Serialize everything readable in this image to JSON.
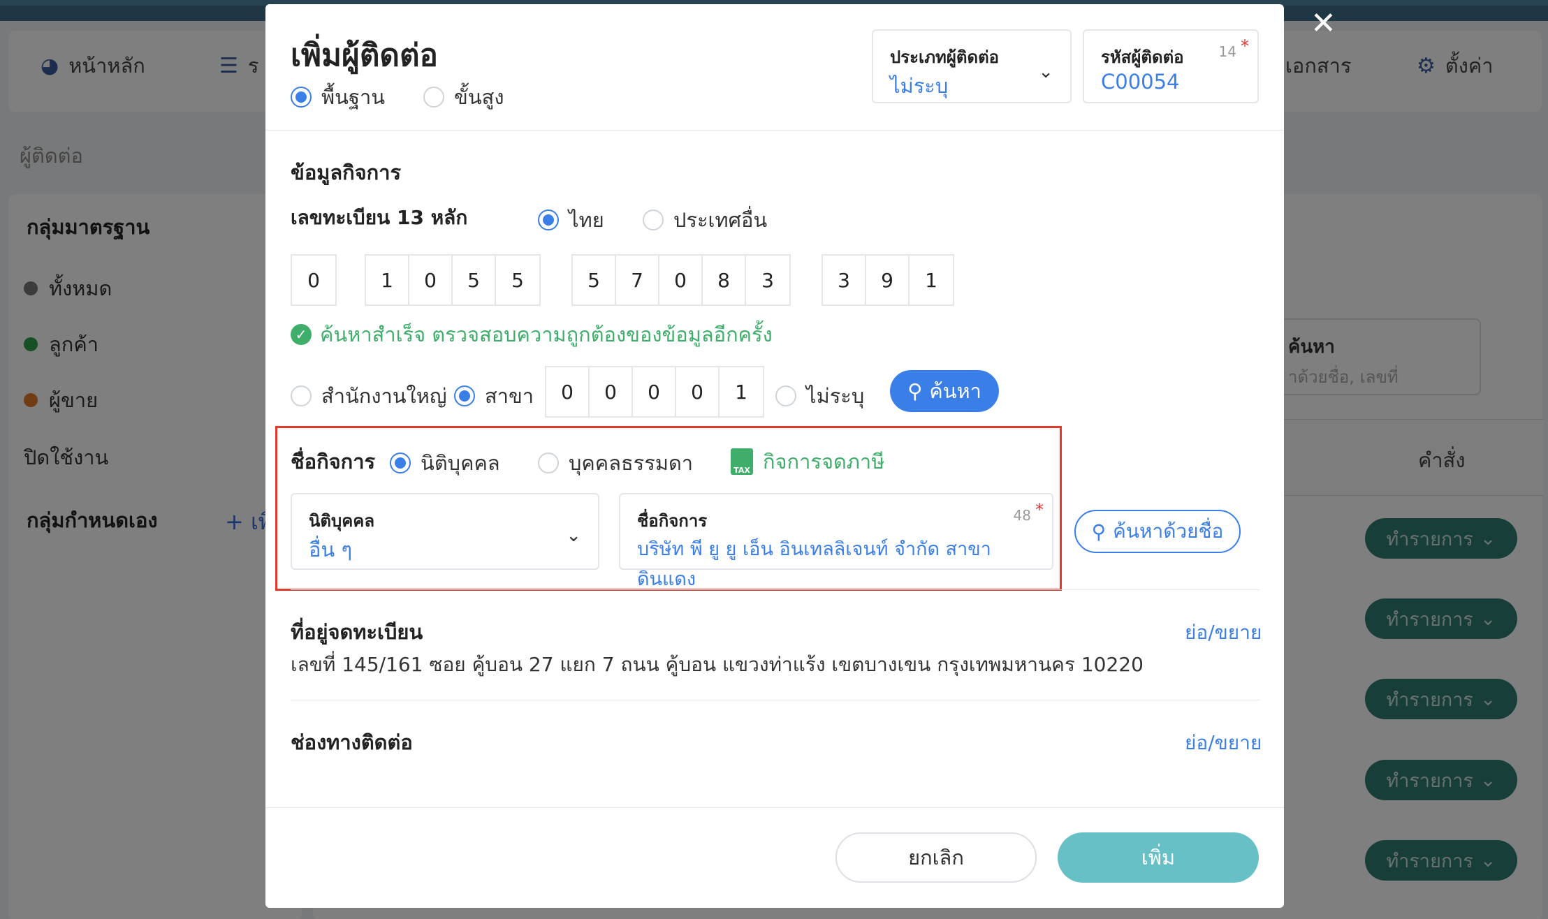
{
  "nav": {
    "home_label": "หน้าหลัก",
    "reports_label": "ร",
    "documents_label": "เอกสาร",
    "settings_label": "ตั้งค่า"
  },
  "breadcrumb": "ผู้ติดต่อ",
  "sidebar": {
    "standard_group_title": "กลุ่มมาตรฐาน",
    "items": [
      {
        "label": "ทั้งหมด",
        "color": "#777777"
      },
      {
        "label": "ลูกค้า",
        "color": "#2e9e4f"
      },
      {
        "label": "ผู้ขาย",
        "color": "#e07b2a"
      }
    ],
    "disabled_label": "ปิดใช้งาน",
    "custom_group_title": "กลุ่มกำหนดเอง",
    "add_label": "+ เพิ่ม"
  },
  "background": {
    "search_label": "ค้นหา",
    "search_placeholder": "าด้วยชื่อ, เลขที่",
    "command_header": "คำสั่ง",
    "action_label": "ทำรายการ"
  },
  "modal": {
    "title": "เพิ่มผู้ติดต่อ",
    "mode_basic": "พื้นฐาน",
    "mode_advanced": "ขั้นสูง",
    "contact_type": {
      "label": "ประเภทผู้ติดต่อ",
      "value": "ไม่ระบุ"
    },
    "contact_code": {
      "label": "รหัสผู้ติดต่อ",
      "value": "C00054",
      "count": "14",
      "required": "*"
    },
    "business_info_title": "ข้อมูลกิจการ",
    "tax_id_label": "เลขทะเบียน 13 หลัก",
    "country_thai": "ไทย",
    "country_other": "ประเทศอื่น",
    "tax_id_groups": [
      [
        "0"
      ],
      [
        "1",
        "0",
        "5",
        "5"
      ],
      [
        "5",
        "7",
        "0",
        "8",
        "3"
      ],
      [
        "3",
        "9",
        "1"
      ]
    ],
    "success_message": "ค้นหาสำเร็จ ตรวจสอบความถูกต้องของข้อมูลอีกครั้ง",
    "head_office": "สำนักงานใหญ่",
    "branch": "สาขา",
    "branch_digits": [
      "0",
      "0",
      "0",
      "0",
      "1"
    ],
    "unspecified": "ไม่ระบุ",
    "search_button": "ค้นหา",
    "business_name_label": "ชื่อกิจการ",
    "entity_juristic": "นิติบุคคล",
    "entity_individual": "บุคคลธรรมดา",
    "vat_registered": "กิจการจดภาษี",
    "tax_icon_text": "TAX",
    "juristic_field": {
      "label": "นิติบุคคล",
      "value": "อื่น ๆ"
    },
    "business_name_field": {
      "label": "ชื่อกิจการ",
      "value": "บริษัท พี ยู ยู เอ็น อินเทลลิเจนท์ จำกัด สาขา ดินแดง",
      "count": "48",
      "required": "*"
    },
    "search_by_name": "ค้นหาด้วยชื่อ",
    "address_title": "ที่อยู่จดทะเบียน",
    "address_toggle": "ย่อ/ขยาย",
    "address_value": "เลขที่ 145/161 ซอย คู้บอน 27 แยก 7 ถนน คู้บอน แขวงท่าแร้ง เขตบางเขน กรุงเทพมหานคร 10220",
    "channel_title": "ช่องทางติดต่อ",
    "channel_toggle": "ย่อ/ขยาย",
    "cancel": "ยกเลิก",
    "add": "เพิ่ม"
  }
}
